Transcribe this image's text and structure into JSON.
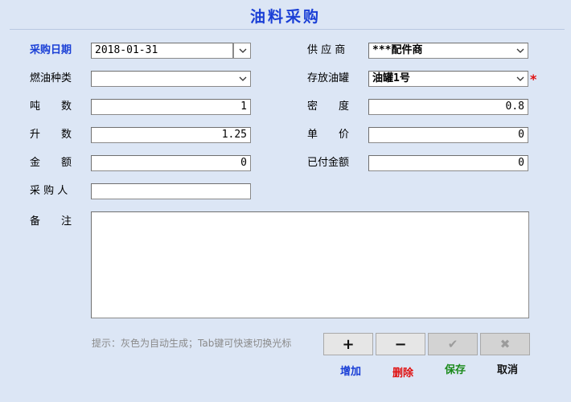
{
  "title": "油料采购",
  "labels": {
    "purchase_date": "采购日期",
    "fuel_type": "燃油种类",
    "tonnage": "吨　　数",
    "liters": "升　　数",
    "amount": "金　　额",
    "purchaser": "采 购 人",
    "remarks": "备　　注",
    "supplier": "供 应 商",
    "storage_tank": "存放油罐",
    "density": "密　　度",
    "unit_price": "单　　价",
    "paid_amount": "已付金额"
  },
  "values": {
    "purchase_date": "2018-01-31",
    "fuel_type": "",
    "tonnage": "1",
    "liters": "1.25",
    "amount": "0",
    "purchaser": "",
    "remarks": "",
    "supplier": "***配件商",
    "storage_tank": "油罐1号",
    "density": "0.8",
    "unit_price": "0",
    "paid_amount": "0"
  },
  "required_mark": "*",
  "hint": "提示：灰色为自动生成；Tab键可快速切换光标",
  "buttons": [
    {
      "symbol": "+",
      "label": "增加",
      "color": "#1a3fd6",
      "enabled": true
    },
    {
      "symbol": "−",
      "label": "删除",
      "color": "#e01010",
      "enabled": true
    },
    {
      "symbol": "✔",
      "label": "保存",
      "color": "#1a8a1a",
      "enabled": false
    },
    {
      "symbol": "✖",
      "label": "取消",
      "color": "#111111",
      "enabled": false
    }
  ]
}
